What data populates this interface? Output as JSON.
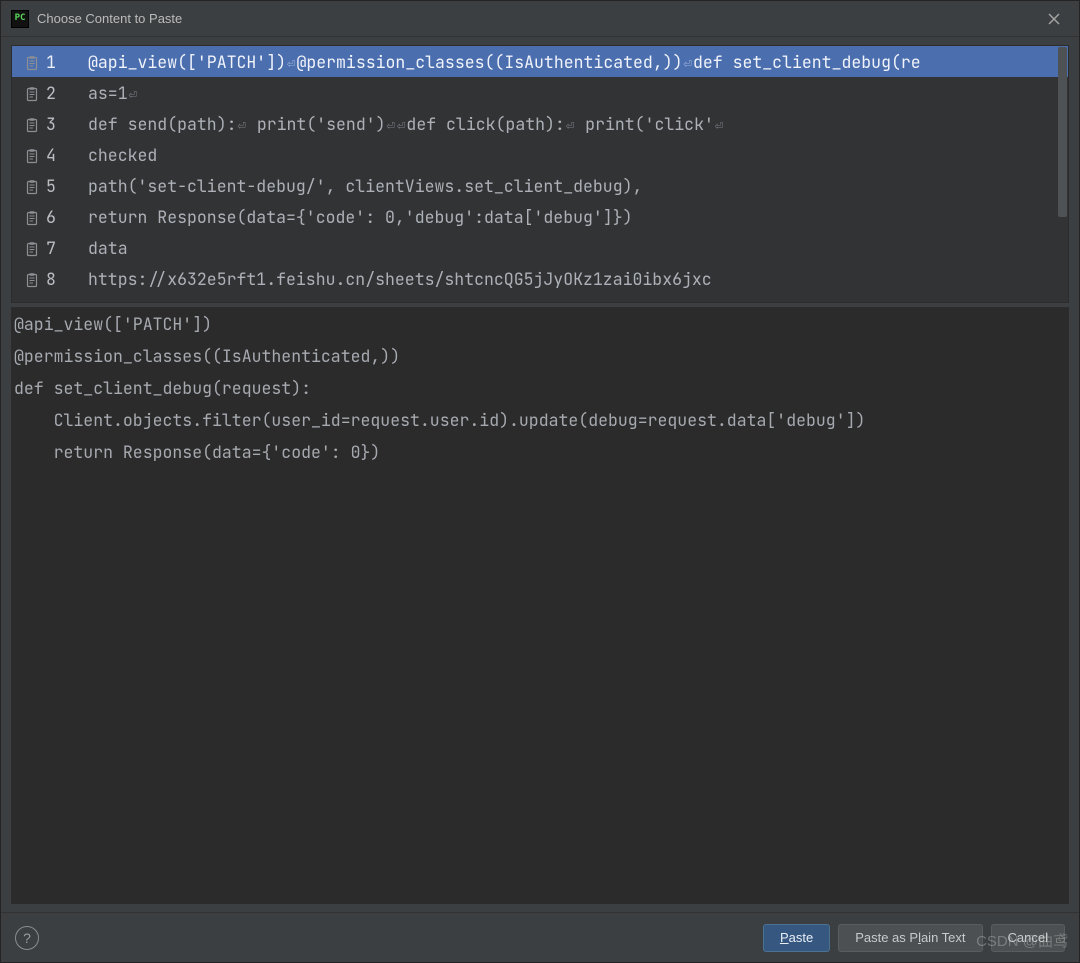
{
  "window": {
    "title": "Choose Content to Paste",
    "app_icon_text": "PC"
  },
  "history": {
    "items": [
      {
        "num": "1",
        "segments": [
          "@api_view(['PATCH'])",
          "⏎",
          "@permission_classes((IsAuthenticated,))",
          "⏎",
          "def set_client_debug(re"
        ],
        "selected": true
      },
      {
        "num": "2",
        "segments": [
          "as=1",
          "⏎"
        ],
        "selected": false
      },
      {
        "num": "3",
        "segments": [
          "def send(path):",
          "⏎",
          "    print('send')",
          "⏎",
          "⏎",
          "def click(path):",
          "⏎",
          "    print('click'",
          "⏎"
        ],
        "selected": false
      },
      {
        "num": "4",
        "segments": [
          "checked"
        ],
        "selected": false
      },
      {
        "num": "5",
        "segments": [
          "path('set-client-debug/', clientViews.set_client_debug),"
        ],
        "selected": false
      },
      {
        "num": "6",
        "segments": [
          "return Response(data={'code': 0,'debug':data['debug']})"
        ],
        "selected": false
      },
      {
        "num": "7",
        "segments": [
          "data"
        ],
        "selected": false
      },
      {
        "num": "8",
        "segments": [
          "https://x632e5rft1.feishu.cn/sheets/shtcncQG5jJyOKz1zai0ibx6jxc"
        ],
        "selected": false
      }
    ]
  },
  "preview": {
    "lines": [
      "@api_view(['PATCH'])",
      "@permission_classes((IsAuthenticated,))",
      "def set_client_debug(request):",
      "    Client.objects.filter(user_id=request.user.id).update(debug=request.data['debug'])",
      "    return Response(data={'code': 0})"
    ]
  },
  "buttons": {
    "help": "?",
    "paste_pre": "",
    "paste_u": "P",
    "paste_post": "aste",
    "plain_pre": "Paste as P",
    "plain_u": "l",
    "plain_post": "ain Text",
    "cancel": "Cancel"
  },
  "watermark": "CSDN @曲鸢"
}
